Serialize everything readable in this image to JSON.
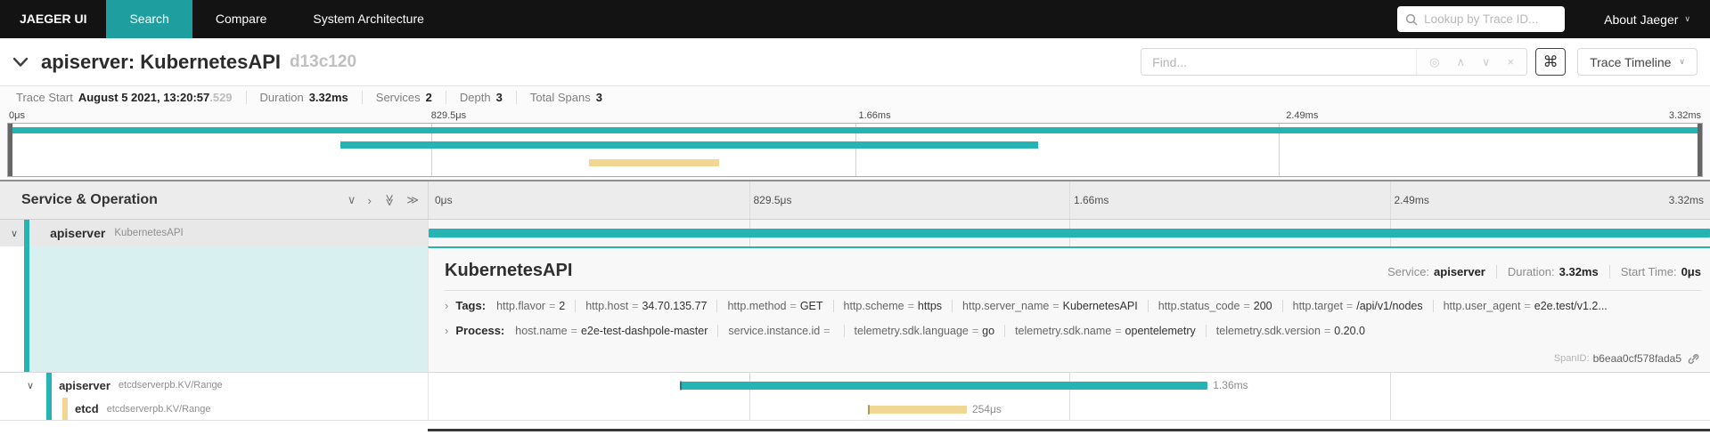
{
  "nav": {
    "brand": "JAEGER UI",
    "tabs": [
      {
        "label": "Search",
        "active": true
      },
      {
        "label": "Compare",
        "active": false
      },
      {
        "label": "System Architecture",
        "active": false
      }
    ],
    "lookup_placeholder": "Lookup by Trace ID...",
    "about_label": "About Jaeger"
  },
  "trace_header": {
    "title": "apiserver: KubernetesAPI",
    "trace_id": "d13c120",
    "find_placeholder": "Find...",
    "view_label": "Trace Timeline"
  },
  "summary": {
    "items": [
      {
        "label": "Trace Start",
        "value": "August 5 2021, 13:20:57",
        "muted": ".529"
      },
      {
        "label": "Duration",
        "value": "3.32ms"
      },
      {
        "label": "Services",
        "value": "2"
      },
      {
        "label": "Depth",
        "value": "3"
      },
      {
        "label": "Total Spans",
        "value": "3"
      }
    ]
  },
  "timeline": {
    "name_column_header": "Service & Operation",
    "ticks": [
      "0μs",
      "829.5μs",
      "1.66ms",
      "2.49ms",
      "3.32ms"
    ]
  },
  "spans": [
    {
      "service": "apiserver",
      "operation": "KubernetesAPI",
      "start_pct": 0,
      "width_pct": 100,
      "color": "#26b3b3",
      "duration_label": ""
    },
    {
      "service": "apiserver",
      "operation": "etcdserverpb.KV/Range",
      "start_pct": 19.6,
      "width_pct": 41.2,
      "color": "#26b3b3",
      "duration_label": "1.36ms"
    },
    {
      "service": "etcd",
      "operation": "etcdserverpb.KV/Range",
      "start_pct": 34.3,
      "width_pct": 7.7,
      "color": "#f2d794",
      "duration_label": "254μs"
    }
  ],
  "detail": {
    "title": "KubernetesAPI",
    "meta": [
      {
        "label": "Service:",
        "value": "apiserver"
      },
      {
        "label": "Duration:",
        "value": "3.32ms"
      },
      {
        "label": "Start Time:",
        "value": "0μs"
      }
    ],
    "tags_label": "Tags:",
    "tags": [
      {
        "k": "http.flavor",
        "v": "2"
      },
      {
        "k": "http.host",
        "v": "34.70.135.77"
      },
      {
        "k": "http.method",
        "v": "GET"
      },
      {
        "k": "http.scheme",
        "v": "https"
      },
      {
        "k": "http.server_name",
        "v": "KubernetesAPI"
      },
      {
        "k": "http.status_code",
        "v": "200"
      },
      {
        "k": "http.target",
        "v": "/api/v1/nodes"
      },
      {
        "k": "http.user_agent",
        "v": "e2e.test/v1.2..."
      }
    ],
    "process_label": "Process:",
    "process": [
      {
        "k": "host.name",
        "v": "e2e-test-dashpole-master"
      },
      {
        "k": "service.instance.id",
        "v": ""
      },
      {
        "k": "telemetry.sdk.language",
        "v": "go"
      },
      {
        "k": "telemetry.sdk.name",
        "v": "opentelemetry"
      },
      {
        "k": "telemetry.sdk.version",
        "v": "0.20.0"
      }
    ],
    "span_id_label": "SpanID:",
    "span_id": "b6eaa0cf578fada5"
  },
  "icons": {
    "chevron_down": "∨",
    "chevron_up": "∧",
    "chevron_right": "›",
    "double_chevron": "≫",
    "close": "×",
    "target": "◎",
    "command": "⌘"
  },
  "sep": {
    "eq": "="
  },
  "colors": {
    "accent": "#1e9e9e",
    "teal_bar": "#26b3b3",
    "yellow_bar": "#f2d794"
  }
}
